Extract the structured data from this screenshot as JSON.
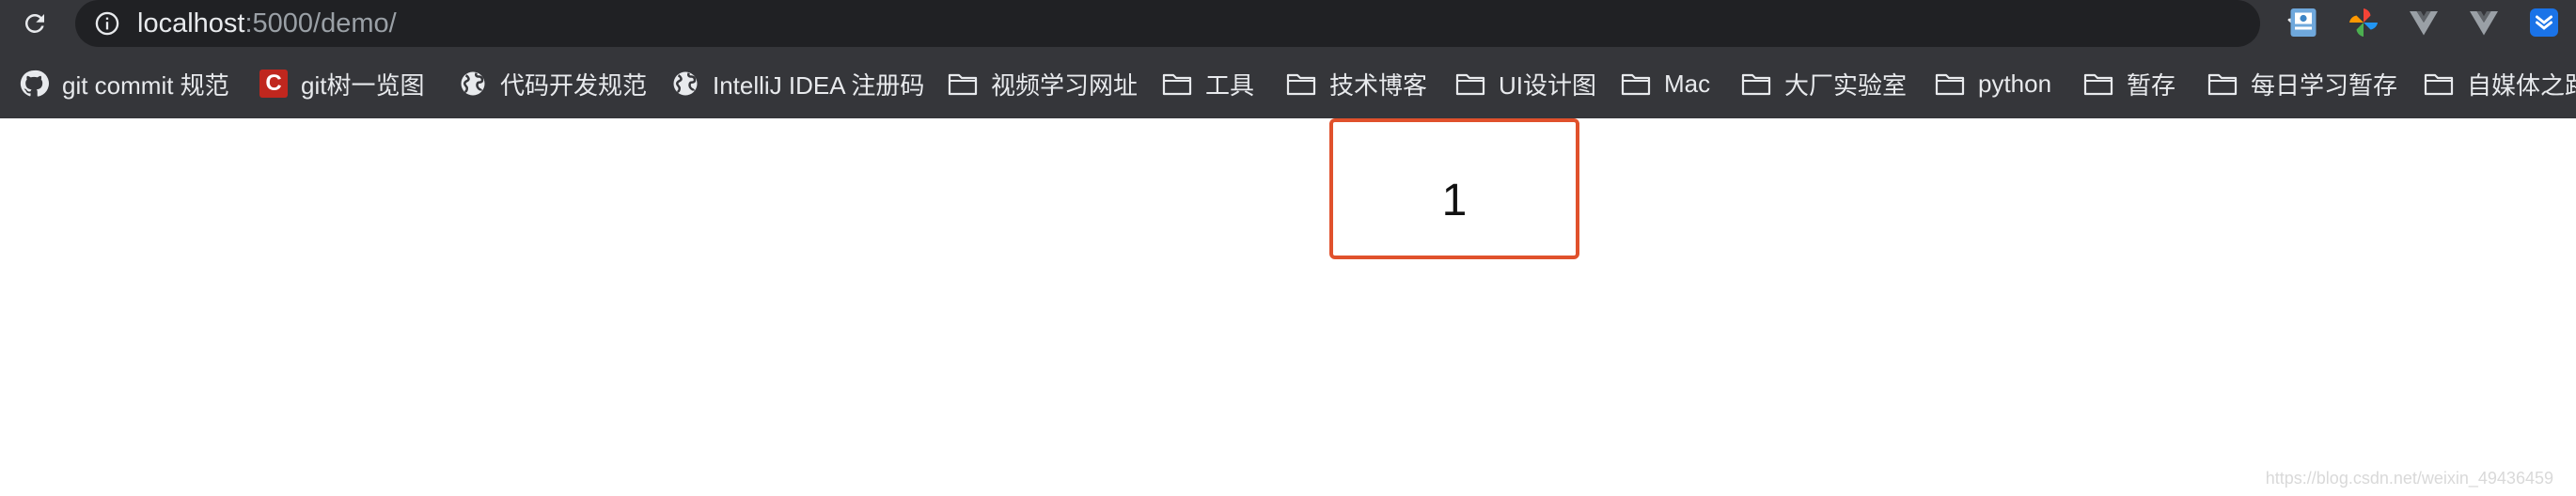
{
  "address_bar": {
    "url_host": "localhost",
    "url_rest": ":5000/demo/"
  },
  "bookmarks": [
    {
      "label": "git commit 规范",
      "icon": "github-icon"
    },
    {
      "label": "git树一览图",
      "icon": "c-logo-icon"
    },
    {
      "label": "代码开发规范",
      "icon": "globe-icon"
    },
    {
      "label": "IntelliJ IDEA 注册码",
      "icon": "globe-icon"
    },
    {
      "label": "视频学习网址",
      "icon": "folder-icon"
    },
    {
      "label": "工具",
      "icon": "folder-icon"
    },
    {
      "label": "技术博客",
      "icon": "folder-icon"
    },
    {
      "label": "UI设计图",
      "icon": "folder-icon"
    },
    {
      "label": "Mac",
      "icon": "folder-icon"
    },
    {
      "label": "大厂实验室",
      "icon": "folder-icon"
    },
    {
      "label": "python",
      "icon": "folder-icon"
    },
    {
      "label": "暂存",
      "icon": "folder-icon"
    },
    {
      "label": "每日学习暂存",
      "icon": "folder-icon"
    },
    {
      "label": "自媒体之路",
      "icon": "folder-icon"
    }
  ],
  "content": {
    "box_value": "1"
  },
  "watermark": "https://blog.csdn.net/weixin_49436459",
  "colors": {
    "toolbar_bg": "#35363a",
    "omnibox_bg": "#202124",
    "box_border": "#e0512c"
  }
}
